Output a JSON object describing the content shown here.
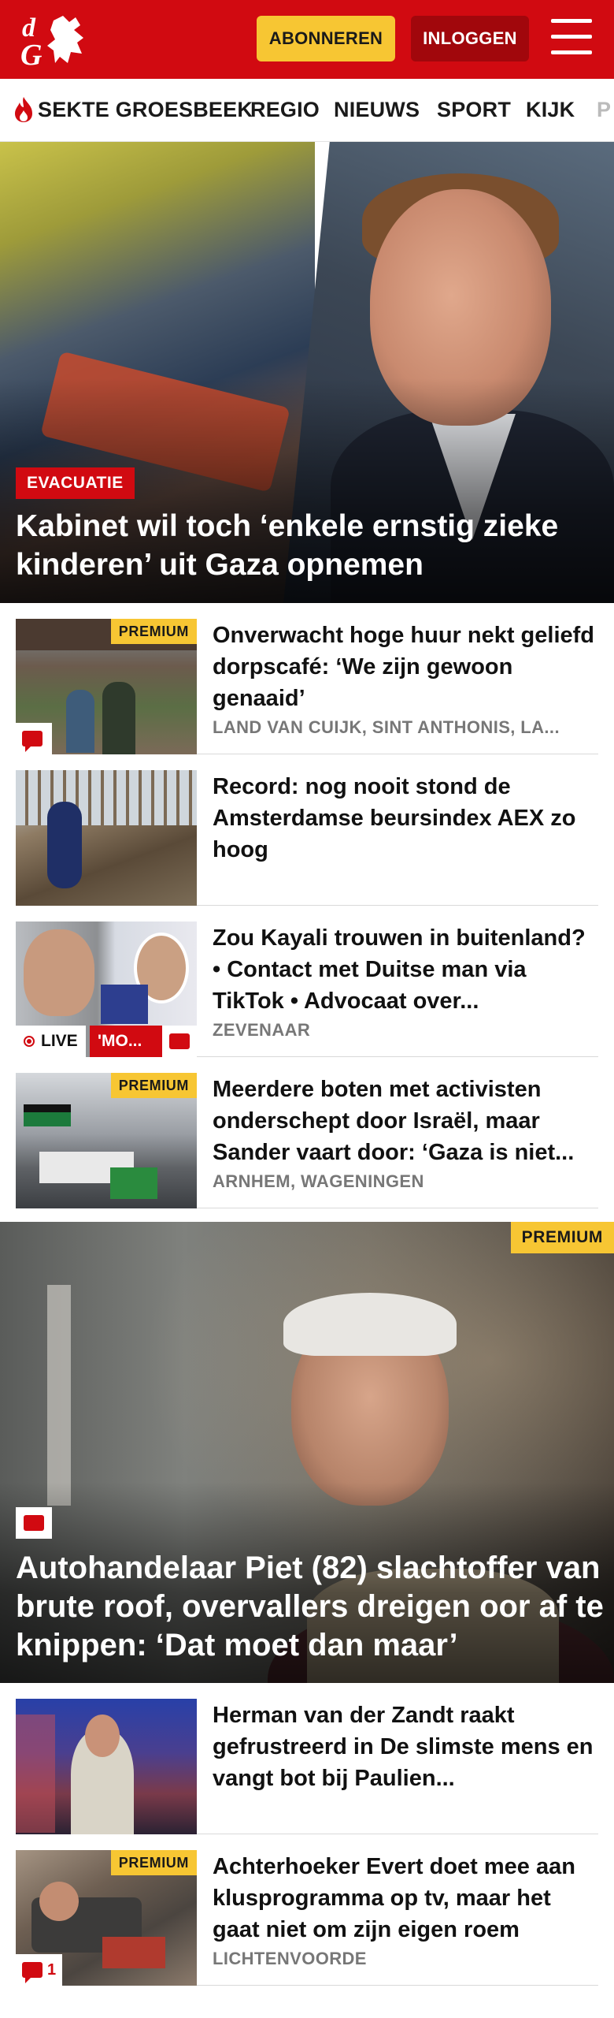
{
  "header": {
    "subscribe_label": "ABONNEREN",
    "login_label": "INLOGGEN",
    "brand_color": "#d10a11",
    "subscribe_color": "#f7c633"
  },
  "nav": {
    "items": [
      {
        "label": "SEKTE GROESBEEK",
        "icon": "flame-icon"
      },
      {
        "label": "REGIO"
      },
      {
        "label": "NIEUWS"
      },
      {
        "label": "SPORT"
      },
      {
        "label": "KIJK"
      },
      {
        "label": "P"
      }
    ]
  },
  "hero": {
    "tag": "EVACUATIE",
    "title": "Kabinet wil toch ‘enkele ernstig zieke kinderen’ uit Gaza opnemen"
  },
  "articles": [
    {
      "title": "Onverwacht hoge huur nekt geliefd dorpscafé: ‘We zijn gewoon genaaid’",
      "location": "LAND VAN CUIJK, SINT ANTHONIS, LA...",
      "premium": "PREMIUM",
      "has_comments": true
    },
    {
      "title": "Record: nog nooit stond de Amsterdamse beursindex AEX zo hoog",
      "location": ""
    },
    {
      "title": "Zou Kayali trouwen in buitenland? • Contact met Duitse man via TikTok • Advocaat over...",
      "location": "ZEVENAAR",
      "live_label": "LIVE",
      "live_topic": "'MO...",
      "has_comments": true
    },
    {
      "title": "Meerdere boten met activisten onderschept door Israël, maar Sander vaart door: ‘Gaza is niet...",
      "location": "ARNHEM, WAGENINGEN",
      "premium": "PREMIUM"
    }
  ],
  "feature": {
    "premium": "PREMIUM",
    "title": "Autohandelaar Piet (82) slachtoffer van brute roof, overvallers dreigen oor af te knippen: ‘Dat moet dan maar’",
    "has_comments": true
  },
  "articles2": [
    {
      "title": "Herman van der Zandt raakt gefrustreerd in De slimste mens en vangt bot bij Paulien...",
      "location": ""
    },
    {
      "title": "Achterhoeker Evert doet mee aan klusprogramma op tv, maar het gaat niet om zijn eigen roem",
      "location": "LICHTENVOORDE",
      "premium": "PREMIUM",
      "comment_count": "1"
    }
  ]
}
